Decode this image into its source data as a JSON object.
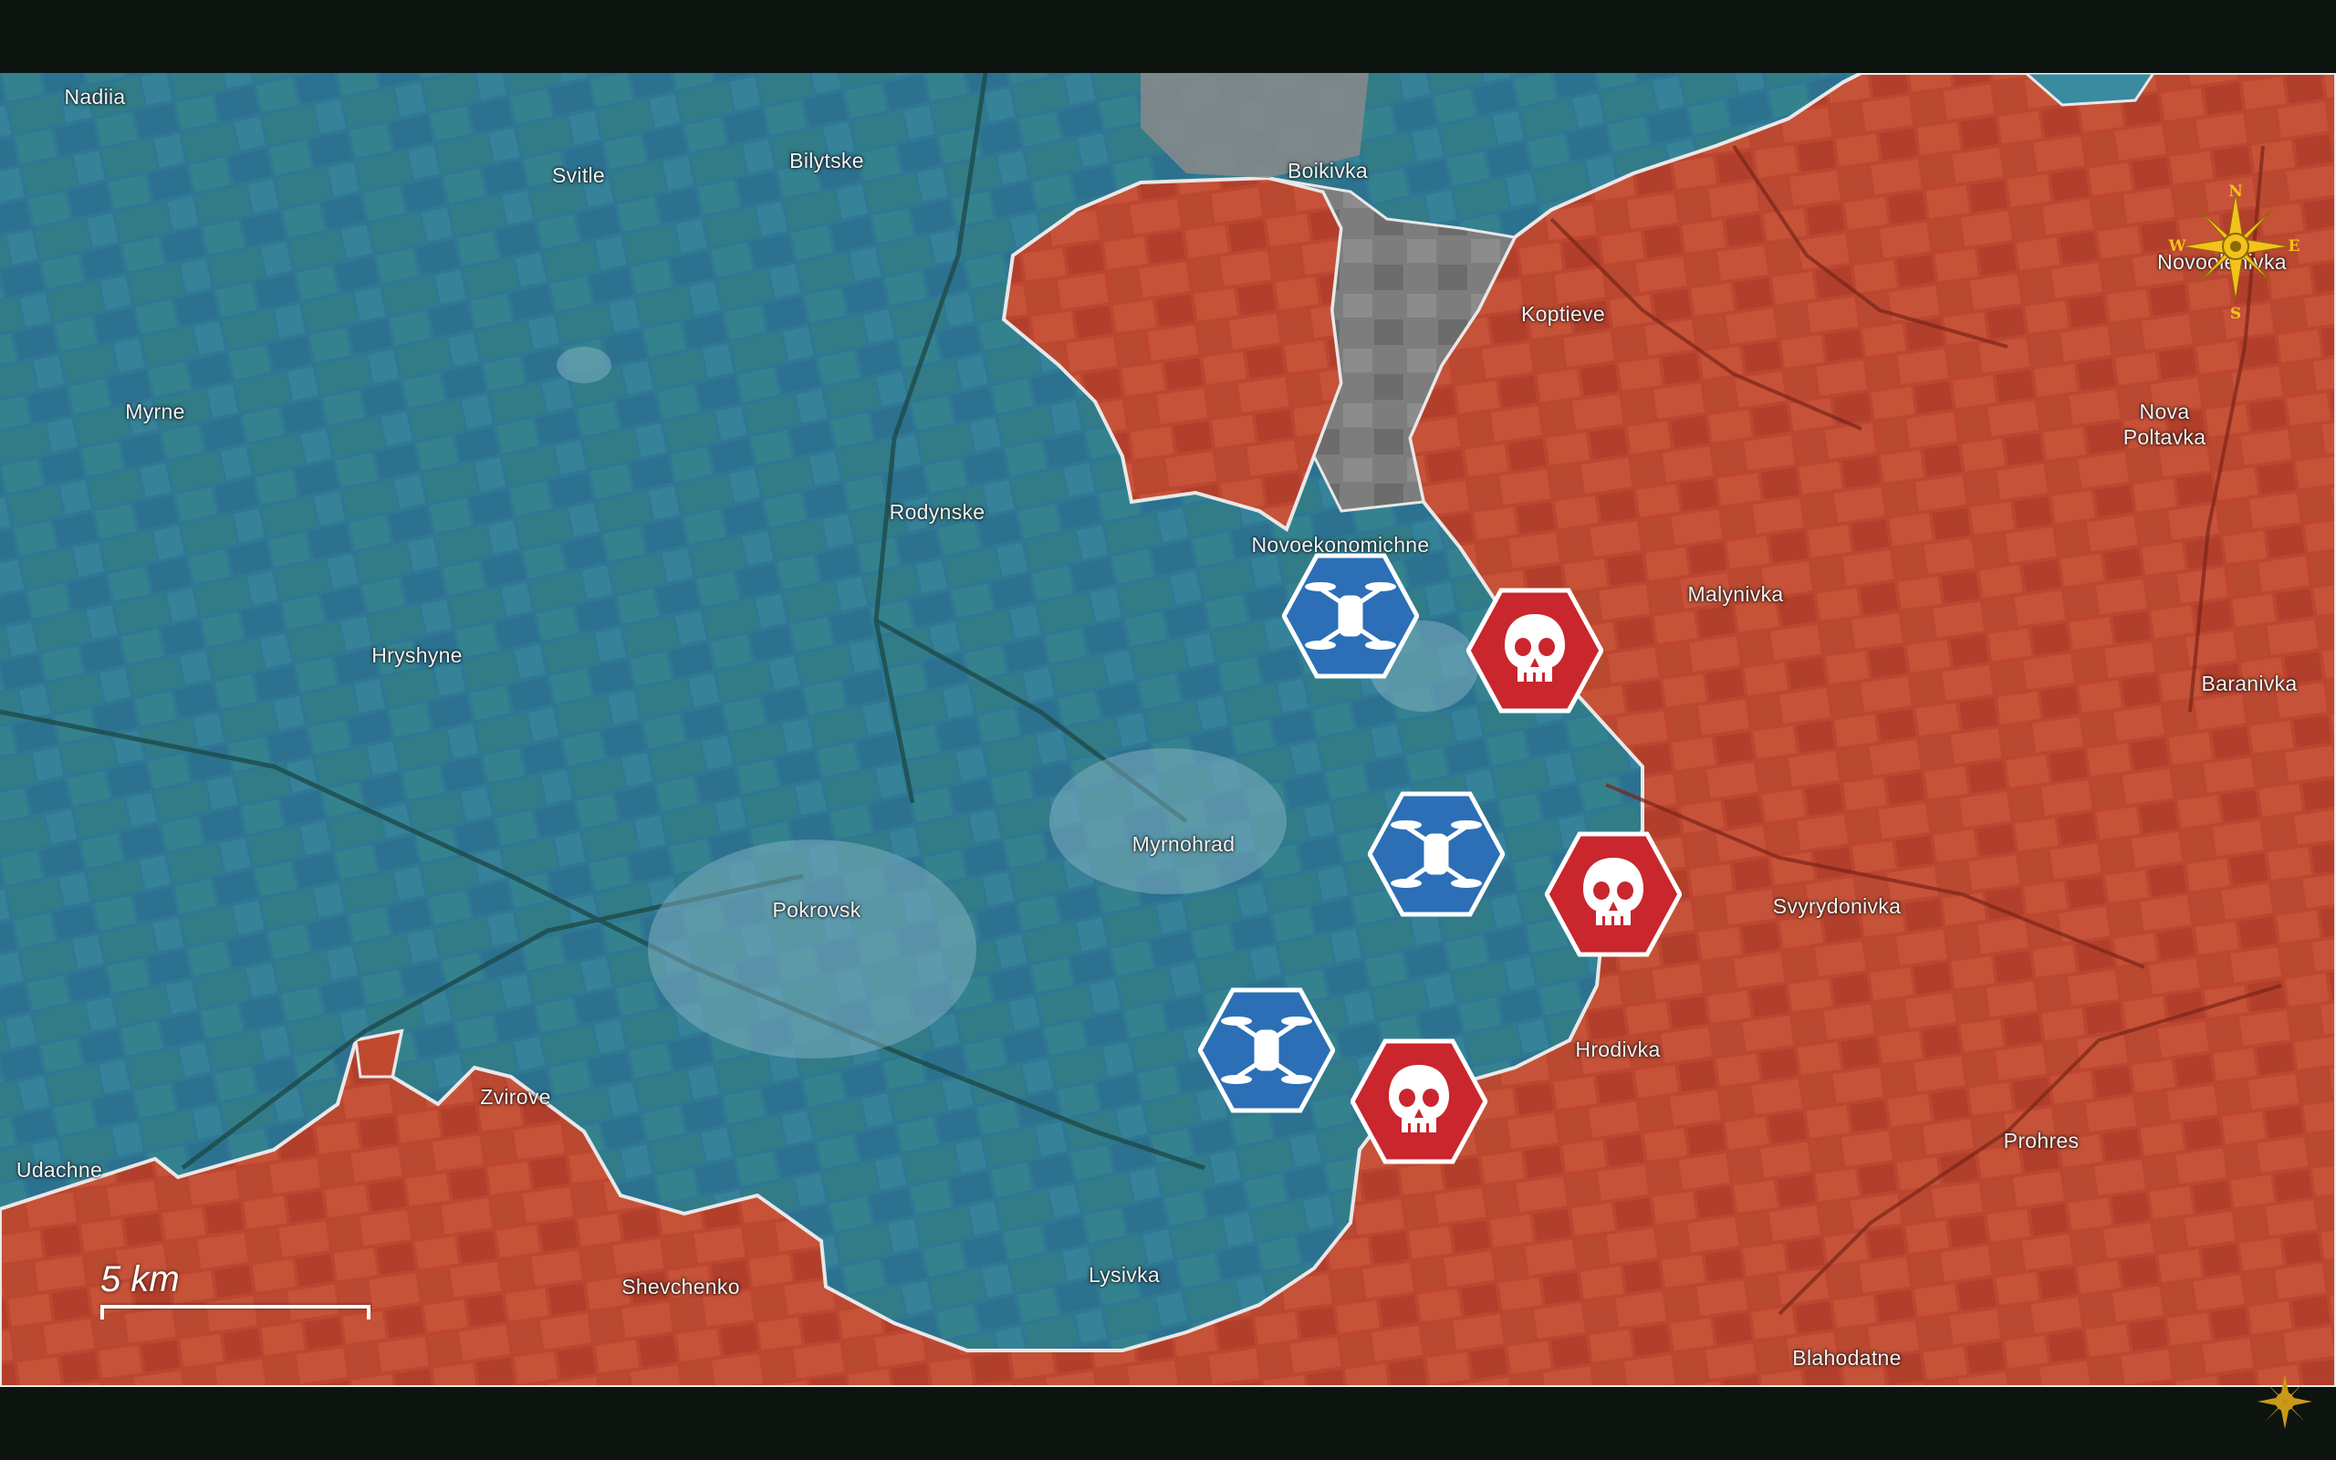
{
  "map": {
    "places": [
      {
        "name": "Nadiia"
      },
      {
        "name": "Svitle"
      },
      {
        "name": "Bilytske"
      },
      {
        "name": "Boikivka"
      },
      {
        "name": "Koptieve"
      },
      {
        "name": "Novoolenivka"
      },
      {
        "name": "Nova\nPoltavka"
      },
      {
        "name": "Myrne"
      },
      {
        "name": "Rodynske"
      },
      {
        "name": "Novoekonomichne"
      },
      {
        "name": "Malynivka"
      },
      {
        "name": "Hryshyne"
      },
      {
        "name": "Baranivka"
      },
      {
        "name": "Myrnohrad"
      },
      {
        "name": "Pokrovsk"
      },
      {
        "name": "Svyrydonivka"
      },
      {
        "name": "Hrodivka"
      },
      {
        "name": "Zvirove"
      },
      {
        "name": "Udachne"
      },
      {
        "name": "Prohres"
      },
      {
        "name": "Lysivka"
      },
      {
        "name": "Shevchenko"
      },
      {
        "name": "Blahodatne"
      }
    ],
    "markers": [
      {
        "type": "drone",
        "color": "#2c6fb6"
      },
      {
        "type": "skull",
        "color": "#c9262e"
      },
      {
        "type": "drone",
        "color": "#2c6fb6"
      },
      {
        "type": "skull",
        "color": "#c9262e"
      },
      {
        "type": "drone",
        "color": "#2c6fb6"
      },
      {
        "type": "skull",
        "color": "#c9262e"
      }
    ],
    "scale_label": "5 km",
    "compass": {
      "n": "N",
      "s": "S",
      "e": "E",
      "w": "W"
    },
    "colors": {
      "controlled": "#2f7f9c",
      "occupied": "#c0482f",
      "contested": "#7a7a7a",
      "border": "#e8e8e8"
    }
  }
}
